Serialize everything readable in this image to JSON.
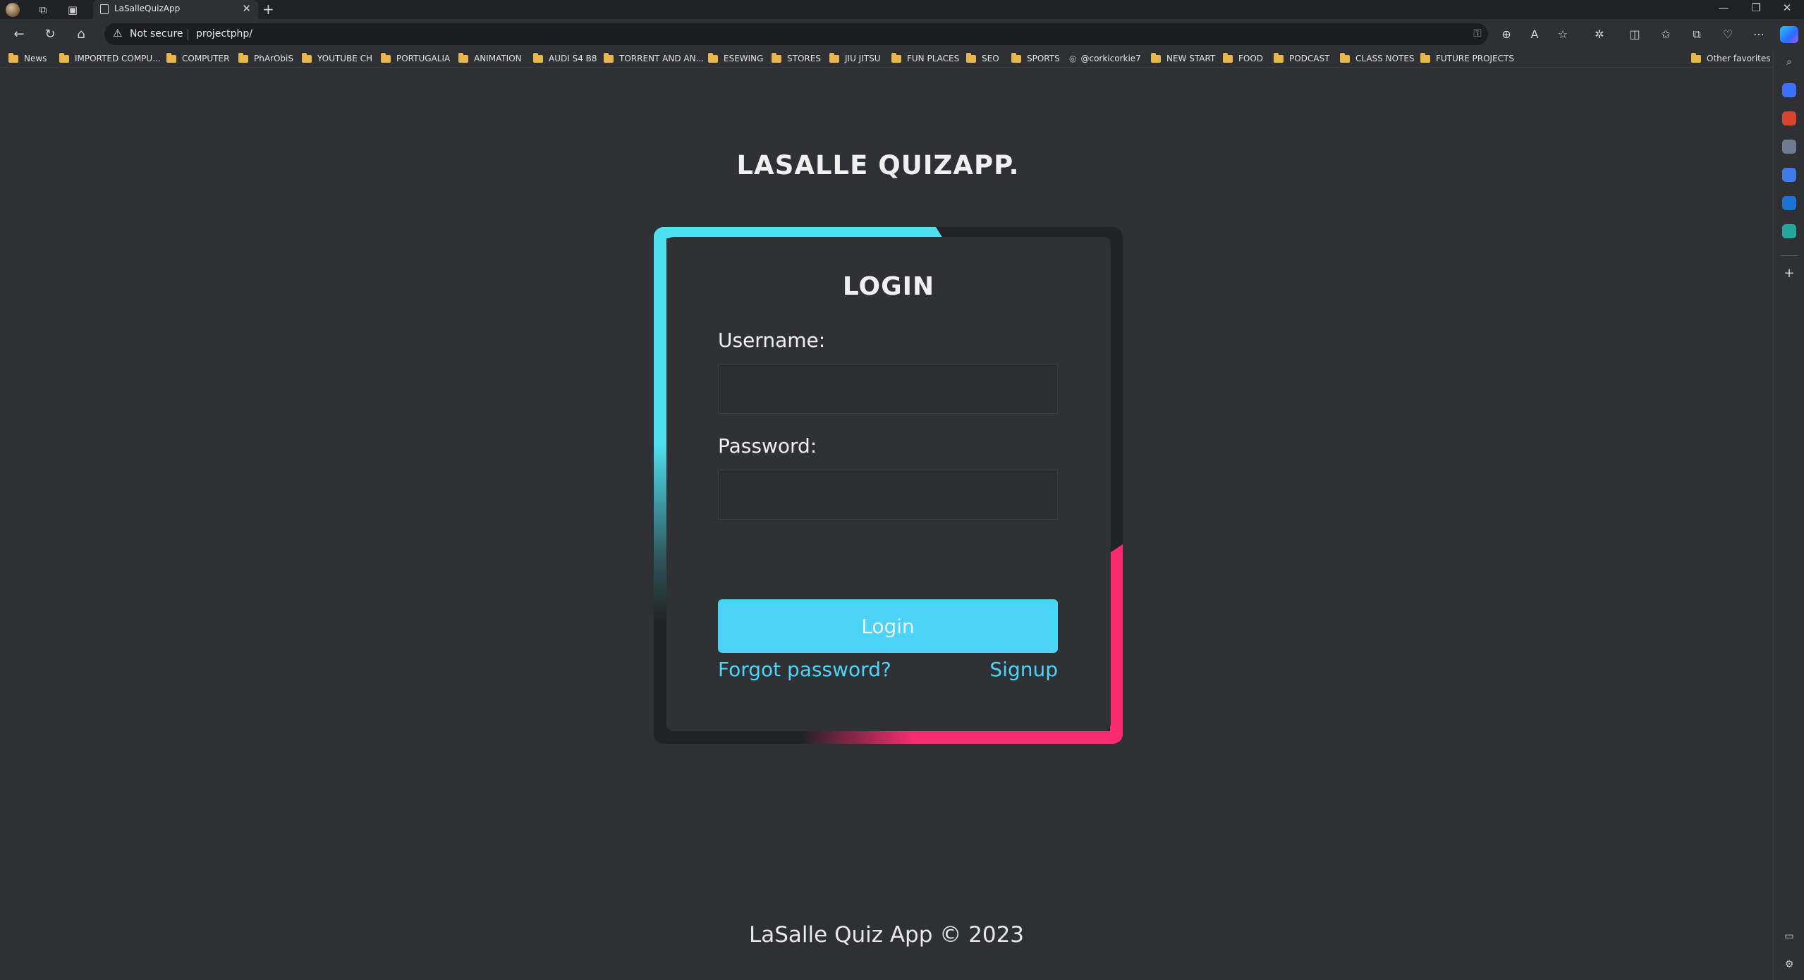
{
  "browser": {
    "tab_title": "LaSalleQuizApp",
    "tab_close": "✕",
    "new_tab": "+",
    "security_label": "Not secure",
    "url": "projectphp/",
    "window_controls": [
      "—",
      "❐",
      "✕"
    ]
  },
  "bookmarks": [
    {
      "label": "News",
      "icon": "folder-icon"
    },
    {
      "label": "IMPORTED COMPU...",
      "icon": "folder-icon"
    },
    {
      "label": "COMPUTER",
      "icon": "folder-icon"
    },
    {
      "label": "PhArObiS",
      "icon": "folder-icon"
    },
    {
      "label": "YOUTUBE CH",
      "icon": "folder-icon"
    },
    {
      "label": "PORTUGALIA",
      "icon": "folder-icon"
    },
    {
      "label": "ANIMATION",
      "icon": "folder-icon"
    },
    {
      "label": "AUDI S4 B8",
      "icon": "folder-icon"
    },
    {
      "label": "TORRENT AND AN...",
      "icon": "folder-icon"
    },
    {
      "label": "ESEWING",
      "icon": "folder-icon"
    },
    {
      "label": "STORES",
      "icon": "folder-icon"
    },
    {
      "label": "JIU JITSU",
      "icon": "folder-icon"
    },
    {
      "label": "FUN PLACES",
      "icon": "folder-icon"
    },
    {
      "label": "SEO",
      "icon": "folder-icon"
    },
    {
      "label": "SPORTS",
      "icon": "folder-icon"
    },
    {
      "label": "@corkicorkie7",
      "icon": "at-icon"
    },
    {
      "label": "NEW START",
      "icon": "folder-icon"
    },
    {
      "label": "FOOD",
      "icon": "folder-icon"
    },
    {
      "label": "PODCAST",
      "icon": "folder-icon"
    },
    {
      "label": "CLASS NOTES",
      "icon": "folder-icon"
    },
    {
      "label": "FUTURE PROJECTS",
      "icon": "folder-icon"
    }
  ],
  "other_favorites": "Other favorites",
  "page": {
    "app_title": "LASALLE QUIZAPP.",
    "login": {
      "heading": "LOGIN",
      "username_label": "Username:",
      "username_value": "",
      "password_label": "Password:",
      "password_value": "",
      "submit_label": "Login",
      "forgot_link": "Forgot password?",
      "signup_link": "Signup"
    },
    "footer": "LaSalle Quiz App © 2023"
  },
  "colors": {
    "page_bg": "#2e3034",
    "card_bg": "#303134",
    "accent_cyan": "#4de0f0",
    "accent_pink": "#fa2c6f",
    "button": "#4ad2f7",
    "link": "#4fd4f6"
  }
}
